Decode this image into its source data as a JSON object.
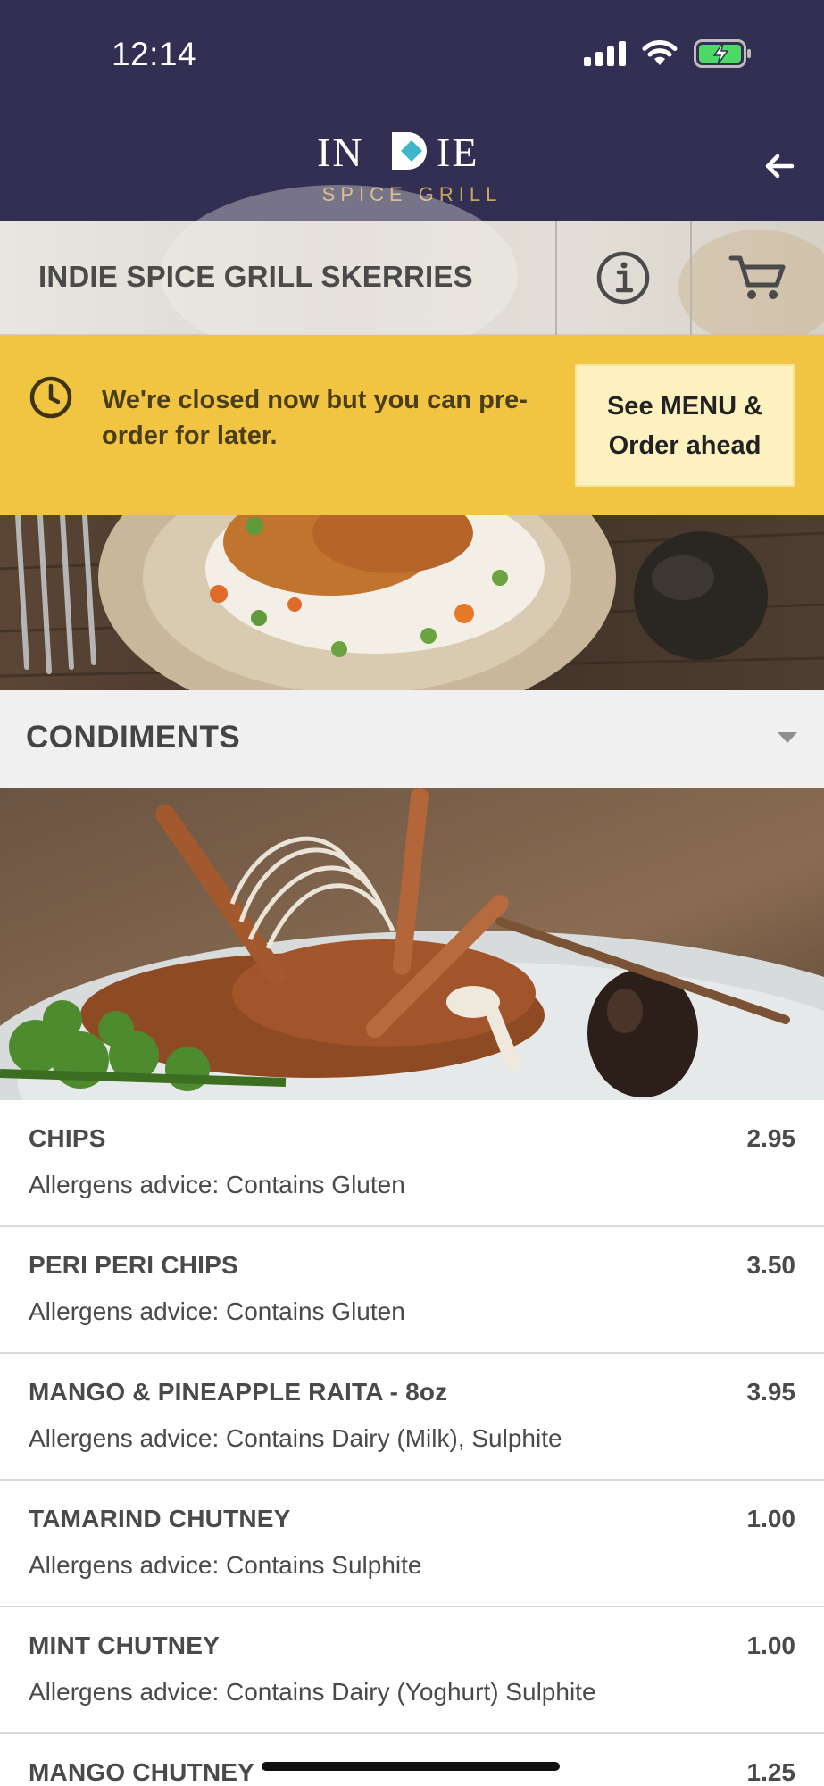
{
  "status_bar": {
    "time": "12:14"
  },
  "header": {
    "logo_text": "INDIE",
    "logo_subtitle": "SPICE GRILL",
    "back_icon": "arrow-left-icon"
  },
  "store": {
    "name": "INDIE SPICE GRILL SKERRIES",
    "info_icon": "info-icon",
    "cart_icon": "cart-icon"
  },
  "banner": {
    "icon": "clock-icon",
    "message": "We're closed now but you can pre-order for later.",
    "button_label_line1": "See MENU &",
    "button_label_line2": "Order ahead"
  },
  "category": {
    "title": "CONDIMENTS",
    "icon": "caret-down-icon"
  },
  "menu_items": [
    {
      "name": "CHIPS",
      "price": "2.95",
      "allergens": "Allergens advice: Contains Gluten"
    },
    {
      "name": "PERI PERI CHIPS",
      "price": "3.50",
      "allergens": "Allergens advice: Contains Gluten"
    },
    {
      "name": "MANGO & PINEAPPLE RAITA - 8oz",
      "price": "3.95",
      "allergens": "Allergens advice: Contains Dairy (Milk), Sulphite"
    },
    {
      "name": "TAMARIND CHUTNEY",
      "price": "1.00",
      "allergens": "Allergens advice: Contains Sulphite"
    },
    {
      "name": "MINT CHUTNEY",
      "price": "1.00",
      "allergens": "Allergens advice: Contains Dairy (Yoghurt) Sulphite"
    },
    {
      "name": "MANGO CHUTNEY",
      "price": "1.25",
      "allergens": ""
    }
  ],
  "colors": {
    "header_bg": "#332f52",
    "banner_bg": "#f1c542",
    "banner_button_bg": "#fdf2bf",
    "logo_accent": "#3fb6c9",
    "logo_subtitle": "#c9a659"
  }
}
